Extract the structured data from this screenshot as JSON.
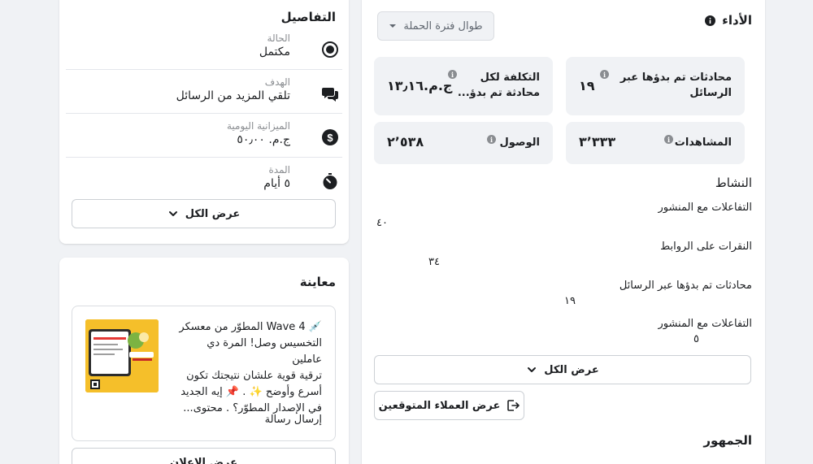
{
  "details": {
    "title": "التفاصيل",
    "rows": [
      {
        "label": "الحالة",
        "value": "مكتمل"
      },
      {
        "label": "الهدف",
        "value": "تلقي المزيد من الرسائل"
      },
      {
        "label": "الميزانية اليومية",
        "value": "ج.م. ٥٠٫٠٠"
      },
      {
        "label": "المدة",
        "value": "٥ أيام"
      }
    ],
    "show_all": "عرض الكل"
  },
  "preview": {
    "title": "معاينة",
    "ad_text_lines": [
      "💉 Wave 4 المطوّر من معسكر",
      "التخسيس وصل! المرة دي عاملين",
      "ترقية قوية علشان نتيجتك تكون",
      "أسرع وأوضح ✨ . 📌 إيه الجديد",
      "في الإصدار المطوّر؟ . محتوى..."
    ],
    "cta": "إرسال رسالة",
    "view_ad_button": "عرض الإعلان"
  },
  "performance": {
    "title": "الأداء",
    "range_dropdown": "طوال فترة الحملة",
    "metrics": [
      {
        "label": "محادثات تم بدؤها عبر الرسائل",
        "value": "١٩"
      },
      {
        "label": "التكلفة لكل محادثة تم بدؤ...",
        "value": "ج.م.١٣٫١٦"
      },
      {
        "label": "المشاهدات",
        "value": "٣٬٣٣٣"
      },
      {
        "label": "الوصول",
        "value": "٢٬٥٣٨"
      }
    ],
    "activity_title": "النشاط",
    "activity": [
      {
        "label": "التفاعلات مع المنشور",
        "value": "٤٠"
      },
      {
        "label": "النقرات على الروابط",
        "value": "٣٤"
      },
      {
        "label": "محادثات تم بدؤها عبر الرسائل",
        "value": "١٩"
      },
      {
        "label": "التفاعلات مع المنشور",
        "value": "٥"
      }
    ],
    "show_all": "عرض الكل",
    "leads_button": "عرض العملاء المتوقعين",
    "audience_title": "الجمهور"
  }
}
